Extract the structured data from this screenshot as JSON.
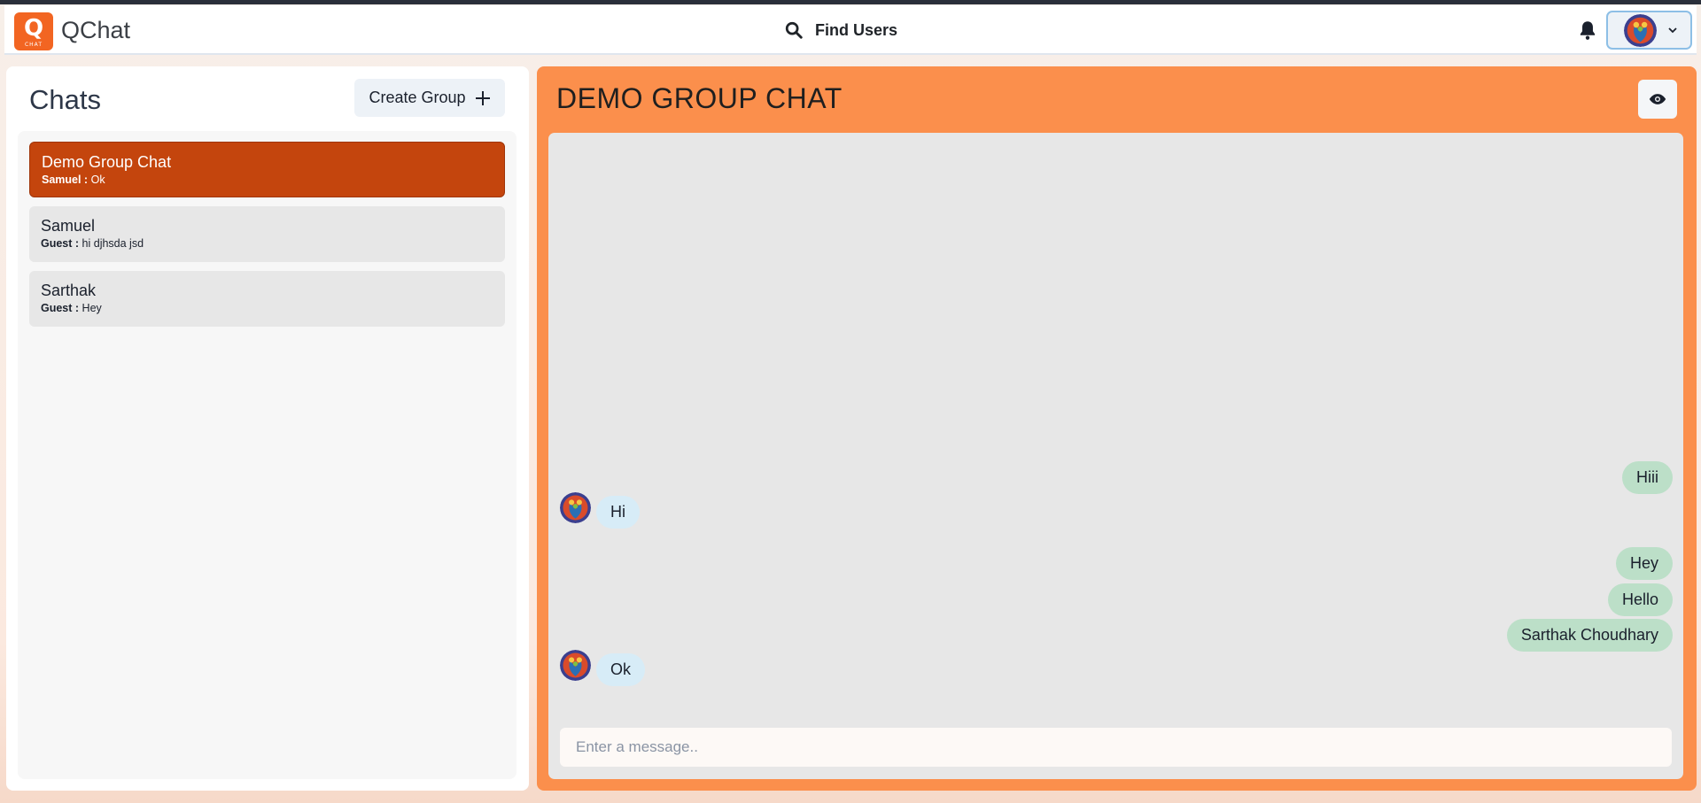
{
  "header": {
    "logo_letter": "Q",
    "logo_sub": "CHAT",
    "app_title": "QChat",
    "search_label": "Find Users"
  },
  "sidebar": {
    "title": "Chats",
    "create_group_label": "Create Group",
    "chats": [
      {
        "name": "Demo Group Chat",
        "sender": "Samuel :",
        "last": "Ok",
        "active": true
      },
      {
        "name": "Samuel",
        "sender": "Guest :",
        "last": "hi djhsda jsd",
        "active": false
      },
      {
        "name": "Sarthak",
        "sender": "Guest :",
        "last": "Hey",
        "active": false
      }
    ]
  },
  "chat": {
    "title": "DEMO GROUP CHAT",
    "messages": [
      {
        "text": "Hiii",
        "mine": true
      },
      {
        "text": "Hi",
        "mine": false
      },
      {
        "text": "Hey",
        "mine": true
      },
      {
        "text": "Hello",
        "mine": true
      },
      {
        "text": "Sarthak Choudhary",
        "mine": true
      },
      {
        "text": "Ok",
        "mine": false
      }
    ],
    "input_placeholder": "Enter a message.."
  },
  "colors": {
    "brand": "#f26522",
    "active_chat": "#c4450d",
    "chat_panel": "#fb8f4c",
    "my_bubble": "#bcdfc8",
    "their_bubble": "#d7ecf7"
  },
  "icons": {
    "search": "search-icon",
    "bell": "bell-icon",
    "chevron": "chevron-down-icon",
    "plus": "plus-icon",
    "eye": "eye-icon"
  }
}
